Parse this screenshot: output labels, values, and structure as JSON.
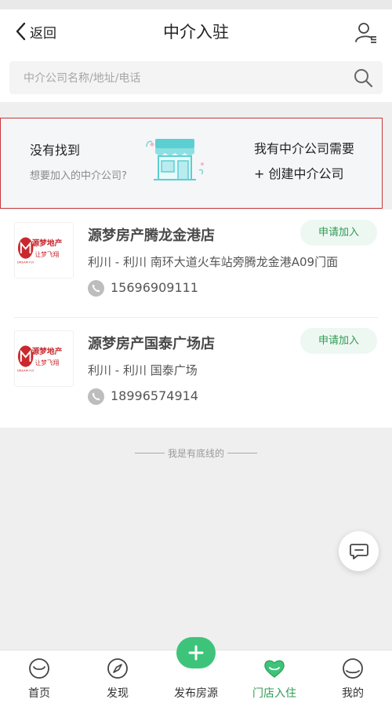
{
  "nav": {
    "back_label": "返回",
    "title": "中介入驻"
  },
  "search": {
    "placeholder": "中介公司名称/地址/电话"
  },
  "not_found": {
    "title": "没有找到",
    "subtitle": "想要加入的中介公司?",
    "right_text": "我有中介公司需要",
    "create_label": "+ 创建中介公司"
  },
  "agencies": [
    {
      "name": "源梦房产腾龙金港店",
      "address": "利川 - 利川 南环大道火车站旁腾龙金港A09门面",
      "phone": "15696909111",
      "apply_label": "申请加入"
    },
    {
      "name": "源梦房产国泰广场店",
      "address": "利川 - 利川 国泰广场",
      "phone": "18996574914",
      "apply_label": "申请加入"
    }
  ],
  "logo": {
    "brand": "源梦地产",
    "slogan": "让梦飞翔",
    "english": "DREAM FLY"
  },
  "bottom_line": "我是有底线的",
  "tabs": [
    {
      "label": "首页",
      "icon": "home-icon",
      "active": false
    },
    {
      "label": "发现",
      "icon": "compass-icon",
      "active": false
    },
    {
      "label": "发布房源",
      "icon": "plus-icon",
      "active": false
    },
    {
      "label": "门店入住",
      "icon": "heart-icon",
      "active": true
    },
    {
      "label": "我的",
      "icon": "profile-icon",
      "active": false
    }
  ],
  "colors": {
    "accent_green": "#2f9b53",
    "fab_green": "#3ec47a",
    "highlight_red": "#c8383a",
    "logo_red": "#c9282d"
  }
}
